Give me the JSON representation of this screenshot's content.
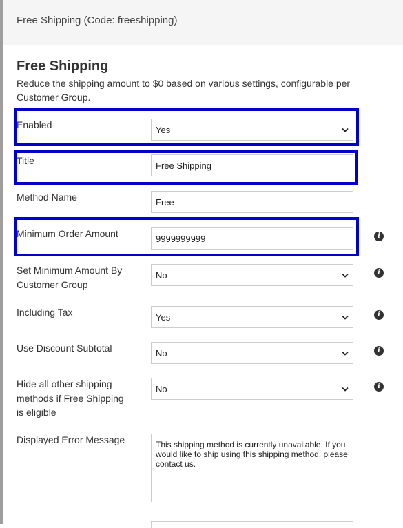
{
  "header": {
    "title": "Free Shipping (Code: freeshipping)"
  },
  "section": {
    "title": "Free Shipping",
    "description": "Reduce the shipping amount to $0 based on various settings, configurable per Customer Group."
  },
  "fields": {
    "enabled": {
      "label": "Enabled",
      "value": "Yes"
    },
    "title": {
      "label": "Title",
      "value": "Free Shipping"
    },
    "method_name": {
      "label": "Method Name",
      "value": "Free"
    },
    "minimum_order_amount": {
      "label": "Minimum Order Amount",
      "value": "9999999999"
    },
    "set_minimum_by_group": {
      "label": "Set Minimum Amount By Customer Group",
      "value": "No"
    },
    "including_tax": {
      "label": "Including Tax",
      "value": "Yes"
    },
    "use_discount_subtotal": {
      "label": "Use Discount Subtotal",
      "value": "No"
    },
    "hide_other_methods": {
      "label": "Hide all other shipping methods if Free Shipping is eligible",
      "value": "No"
    },
    "error_message": {
      "label": "Displayed Error Message",
      "value": "This shipping method is currently unavailable. If you would like to ship using this shipping method, please contact us."
    }
  },
  "icons": {
    "info": "i",
    "dropdown": "chevron-down-icon"
  },
  "colors": {
    "highlight": "#0000cc",
    "header_bg": "#f5f5f5"
  }
}
